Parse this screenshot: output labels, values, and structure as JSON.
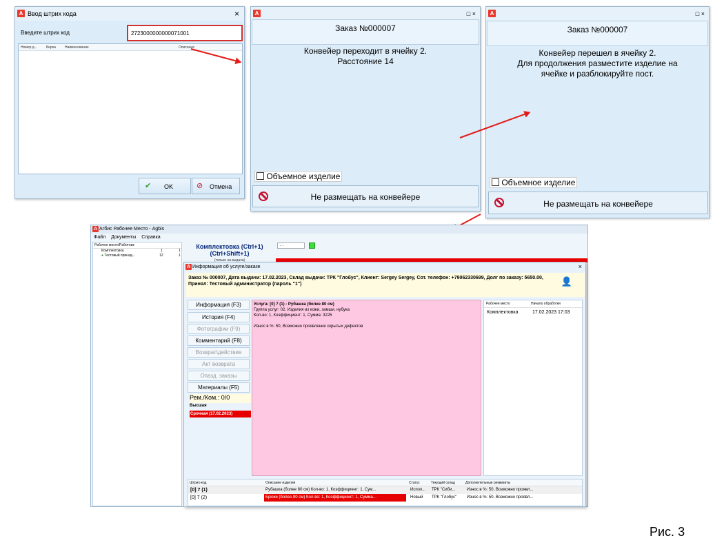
{
  "barcode_dialog": {
    "title": "Ввод штрих кода",
    "close": "×",
    "label": "Введите штрих код",
    "value": "2723000000000071001",
    "columns": [
      "Номер д...",
      "Бирка",
      "Наименование",
      "Описание"
    ],
    "ok": "OK",
    "cancel": "Отмена"
  },
  "panel_moving": {
    "order": "Заказ №000007",
    "message_line1": "Конвейер переходит в ячейку 2.",
    "message_line2": "Расстояние 14",
    "checkbox": "Объемное изделие",
    "button": "Не размещать на конвейере",
    "controls": "□ ×"
  },
  "panel_moved": {
    "order": "Заказ №000007",
    "message_line1": "Конвейер перешел в ячейку 2.",
    "message_line2": "Для продолжения разместите изделие на",
    "message_line3": "ячейке и разблокируйте пост.",
    "checkbox": "Объемное изделие",
    "button": "Не размещать на конвейере",
    "controls": "□ ×"
  },
  "main_app": {
    "title": "Агбис Рабочее Место - Agbis",
    "menu": [
      "Файл",
      "Документы",
      "Справка"
    ],
    "tree_header": "Рабочее место/Работник",
    "tree_items": [
      {
        "label": "Комплектовка",
        "a": "1",
        "b": "1"
      },
      {
        "label": "Тестовый принад...",
        "a": "12",
        "b": "1"
      }
    ],
    "heading1": "Комплектовка (Ctrl+1)",
    "heading2": "(Ctrl+Shift+1)",
    "heading3": "(только на выдача)",
    "date_field": ". .",
    "accent": "#e60000"
  },
  "info_dialog": {
    "title": "Информация об услуге/заказе",
    "close": "×",
    "header_line1": "Заказ № 000007, Дата выдачи: 17.02.2023, Склад выдачи: ТРК \"Глобус\", Клиент: Sergey Sergey, Сот. телефон: +79062330699, Долг по заказу: 5650.00,",
    "header_line2": "Принял: Тестовый администратор (пароль \"1\")",
    "side_buttons": [
      {
        "label": "Информация (F3)",
        "enabled": true
      },
      {
        "label": "История (F4)",
        "enabled": true
      },
      {
        "label": "Фотографии (F9)",
        "enabled": false
      },
      {
        "label": "Комментарий (F8)",
        "enabled": true
      },
      {
        "label": "Возврат\\действие",
        "enabled": false
      },
      {
        "label": "Акт возврата",
        "enabled": false
      },
      {
        "label": "Опазд. заказы",
        "enabled": false
      },
      {
        "label": "Материалы (F5)",
        "enabled": true
      }
    ],
    "rem_kom": "Рем./Ком.: 0/0",
    "priority": "Высшая",
    "urgent": "Срочная (17.02.2023)",
    "service_line1": "Услуга: [0] 7 (1) - Рубашка (более 80 см)",
    "service_line2": "Группа услуг: 02. Изделия из кожи, замши, нубука",
    "service_line3": "Кол-во: 1, Коэффициент: 1, Сумма: 3225",
    "service_line4": "Износ в %: 50, Возможно проявление скрытых дефектов",
    "work_columns": [
      "Рабочее место",
      "Начало обработки"
    ],
    "work_rows": [
      {
        "place": "Комплектовка",
        "start": "17.02.2023 17:03"
      }
    ],
    "bottom_columns": [
      "Штрих-код",
      "Описание изделия",
      "Статус",
      "Текущий склад",
      "Дополнительные реквизиты"
    ],
    "bottom_rows": [
      {
        "code": "[0] 7 (1)",
        "desc": "Рубашка (более 80 см) Кол-во: 1, Коэффициент: 1, Сум...",
        "status": "Испол...",
        "store": "ТРК \"Сиби...",
        "extra": "Износ в %: 50, Возможно проявл..."
      },
      {
        "code": "[0] 7 (2)",
        "desc": "Брюки (более 80 см) Кол-во: 1, Коэффициент: 1, Сумма...",
        "status": "Новый",
        "store": "ТРК \"Глобус\"",
        "extra": "Износ в %: 50, Возможно проявл..."
      }
    ]
  },
  "caption": "Рис. 3"
}
